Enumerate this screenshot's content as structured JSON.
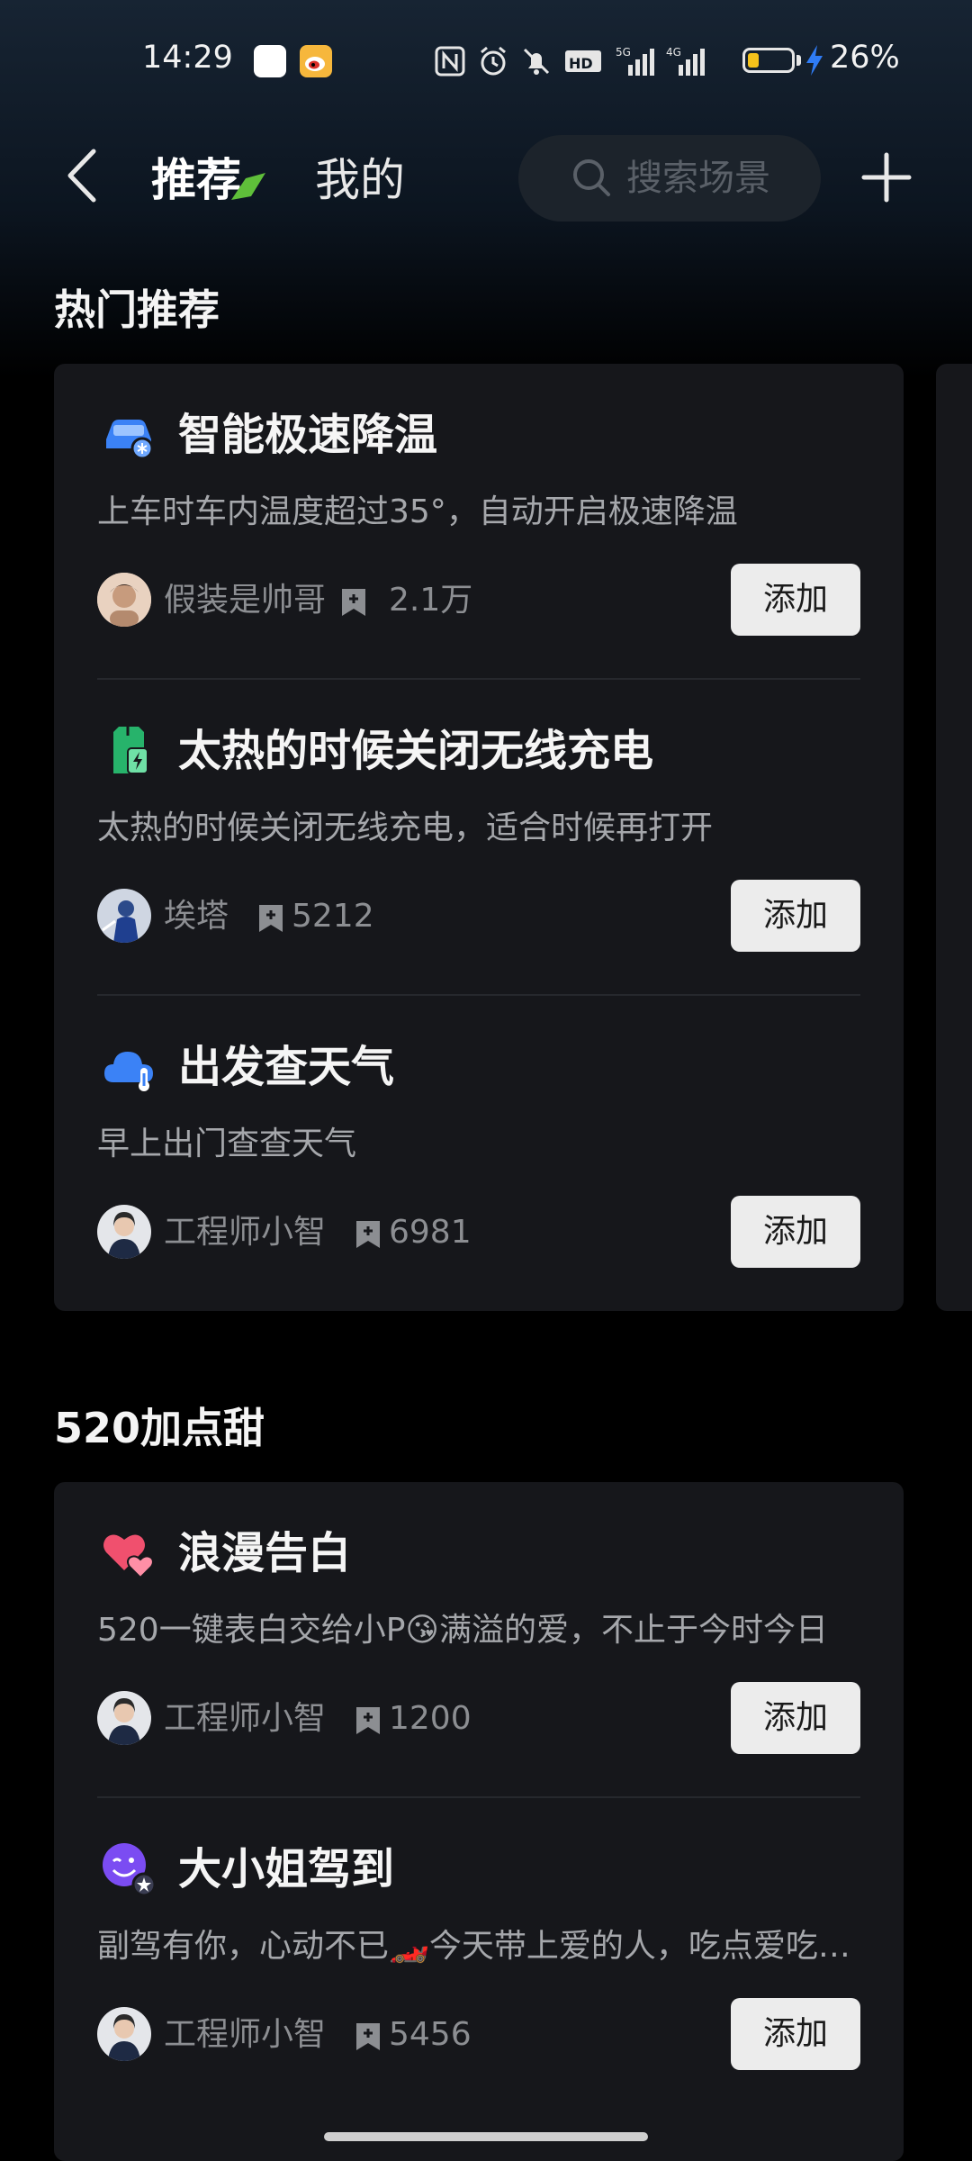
{
  "status_bar": {
    "time": "14:29",
    "battery_percent": "26%",
    "battery_level": 0.26,
    "icons": [
      "white-app-icon",
      "weibo-icon",
      "nfc-icon",
      "alarm-icon",
      "mute-bell-icon",
      "hd-voice-icon",
      "5g-signal-icon",
      "4g-signal-icon",
      "battery-icon",
      "charging-icon"
    ]
  },
  "header": {
    "back_icon": "chevron-left-icon",
    "tabs": [
      {
        "label": "推荐",
        "active": true
      },
      {
        "label": "我的",
        "active": false
      }
    ],
    "search_placeholder": "搜索场景",
    "add_icon": "plus-icon"
  },
  "sections": [
    {
      "title": "热门推荐",
      "items": [
        {
          "icon": "car-cool-icon",
          "title": "智能极速降温",
          "desc": "上车时车内温度超过35°，自动开启极速降温",
          "author": "假装是帅哥",
          "count": "2.1万",
          "button": "添加"
        },
        {
          "icon": "wireless-charge-icon",
          "title": "太热的时候关闭无线充电",
          "desc": "太热的时候关闭无线充电，适合时候再打开",
          "author": "埃塔",
          "count": "5212",
          "button": "添加"
        },
        {
          "icon": "cloud-weather-icon",
          "title": "出发查天气",
          "desc": "早上出门查查天气",
          "author": "工程师小智",
          "count": "6981",
          "button": "添加"
        }
      ]
    },
    {
      "title": "520加点甜",
      "items": [
        {
          "icon": "hearts-icon",
          "title": "浪漫告白",
          "desc": "520一键表白交给小P😘满溢的爱，不止于今时今日",
          "author": "工程师小智",
          "count": "1200",
          "button": "添加"
        },
        {
          "icon": "wink-face-icon",
          "title": "大小姐驾到",
          "desc": "副驾有你，心动不已🏎️今天带上爱的人，吃点爱吃…",
          "author": "工程师小智",
          "count": "5456",
          "button": "添加"
        }
      ]
    }
  ],
  "colors": {
    "background": "#000000",
    "card": "#16171b",
    "button_bg": "#ececec",
    "accent_green": "#4caf50"
  }
}
